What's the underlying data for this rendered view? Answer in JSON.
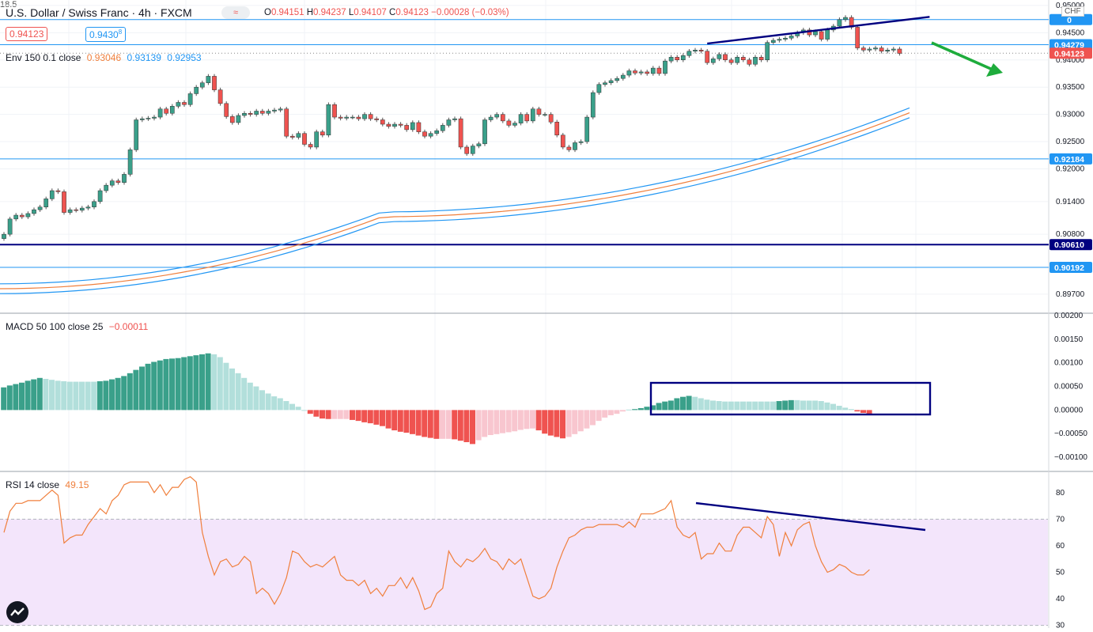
{
  "header": {
    "title": "U.S. Dollar / Swiss Franc · 4h · FXCM",
    "ohlc": {
      "o_label": "O",
      "o": "0.94151",
      "h_label": "H",
      "h": "0.94237",
      "l_label": "L",
      "l": "0.94107",
      "c_label": "C",
      "c": "0.94123",
      "chg": "−0.00028 (−0.03%)"
    },
    "bid": "0.94123",
    "spread": "18.5",
    "ask": "0.9430",
    "ask_sup": "8",
    "currency": "CHF",
    "compare_icon": "≈"
  },
  "colors": {
    "up": "#3aa08a",
    "down": "#ef5350",
    "up_light": "#b2dfdb",
    "down_light": "#f8c6cf",
    "env_mid": "#f07f3c",
    "env_band": "#2196f3",
    "trend": "#000080",
    "arrow": "#1eac3c",
    "rsi": "#f07f3c",
    "rsi_band": "#f3e5fb"
  },
  "indicators": {
    "env": {
      "label": "Env 150 0.1 close",
      "v1": "0.93046",
      "v2": "0.93139",
      "v3": "0.92953"
    },
    "macd": {
      "label": "MACD 50 100 close 25",
      "value": "−0.00011"
    },
    "rsi": {
      "label": "RSI 14 close",
      "value": "49.15"
    }
  },
  "chart_data": [
    {
      "type": "candlestick",
      "name": "price",
      "ylim": [
        0.8935,
        0.951
      ],
      "y_ticks": [
        "0.95000",
        "0.94500",
        "0.94000",
        "0.93500",
        "0.93000",
        "0.92500",
        "0.92000",
        "0.91400",
        "0.90800",
        "0.89700"
      ],
      "tick_values": [
        0.95,
        0.945,
        0.94,
        0.935,
        0.93,
        0.925,
        0.92,
        0.914,
        0.908,
        0.897
      ],
      "horizontal_levels": [
        {
          "value": 0.9474,
          "label": "0",
          "color": "#2196f3"
        },
        {
          "value": 0.94279,
          "label": "0.94279",
          "color": "#2196f3"
        },
        {
          "value": 0.94123,
          "label": "0.94123",
          "color": "#ef5350"
        },
        {
          "value": 0.92184,
          "label": "0.92184",
          "color": "#2196f3"
        },
        {
          "value": 0.9061,
          "label": "0.90610",
          "color": "#000080"
        },
        {
          "value": 0.90192,
          "label": "0.90192",
          "color": "#2196f3"
        }
      ],
      "closes": [
        0.908,
        0.9108,
        0.9115,
        0.9112,
        0.9118,
        0.9125,
        0.913,
        0.9145,
        0.916,
        0.9158,
        0.912,
        0.9125,
        0.9124,
        0.9128,
        0.913,
        0.914,
        0.916,
        0.917,
        0.9178,
        0.9175,
        0.919,
        0.9235,
        0.929,
        0.9292,
        0.9293,
        0.9295,
        0.931,
        0.9302,
        0.9315,
        0.9322,
        0.9318,
        0.9338,
        0.935,
        0.9358,
        0.937,
        0.9345,
        0.932,
        0.9296,
        0.9285,
        0.9298,
        0.9302,
        0.93,
        0.9306,
        0.9302,
        0.9306,
        0.9308,
        0.931,
        0.926,
        0.9258,
        0.9265,
        0.9245,
        0.924,
        0.9268,
        0.9262,
        0.9318,
        0.9295,
        0.9293,
        0.9295,
        0.9295,
        0.9292,
        0.93,
        0.9292,
        0.929,
        0.9282,
        0.9278,
        0.9282,
        0.928,
        0.9272,
        0.9285,
        0.9268,
        0.926,
        0.9265,
        0.927,
        0.928,
        0.929,
        0.9292,
        0.924,
        0.9228,
        0.9242,
        0.9246,
        0.929,
        0.9295,
        0.93,
        0.9288,
        0.928,
        0.9284,
        0.93,
        0.9288,
        0.931,
        0.93,
        0.93,
        0.9286,
        0.9262,
        0.924,
        0.9235,
        0.9248,
        0.925,
        0.9295,
        0.934,
        0.9355,
        0.9358,
        0.9362,
        0.9366,
        0.9372,
        0.938,
        0.9376,
        0.9378,
        0.9375,
        0.9385,
        0.9375,
        0.9398,
        0.9405,
        0.94,
        0.9408,
        0.9416,
        0.9418,
        0.9416,
        0.9395,
        0.9402,
        0.941,
        0.94,
        0.9395,
        0.9405,
        0.94,
        0.9392,
        0.9405,
        0.94,
        0.9432,
        0.9436,
        0.9438,
        0.944,
        0.9444,
        0.945,
        0.9455,
        0.9446,
        0.9452,
        0.9438,
        0.9455,
        0.9462,
        0.9474,
        0.9478,
        0.946,
        0.9422,
        0.9418,
        0.942,
        0.9422,
        0.9416,
        0.9418,
        0.942,
        0.9412
      ],
      "envelope": {
        "upper": [
          0.8989,
          0.9121,
          0.9312
        ],
        "middle": [
          0.898,
          0.9112,
          0.9303
        ],
        "lower": [
          0.8971,
          0.9103,
          0.9294
        ],
        "x": [
          0,
          0.42,
          1
        ]
      },
      "trendline": {
        "from": [
          117,
          0.943
        ],
        "to": [
          154,
          0.9479
        ]
      },
      "arrow": {
        "direction": "down-right"
      }
    },
    {
      "type": "histogram",
      "name": "MACD 50 100 close 25",
      "ylim": [
        -0.0013,
        0.00205
      ],
      "y_ticks": [
        "0.00200",
        "0.00150",
        "0.00100",
        "0.00050",
        "0.00000",
        "−0.00050",
        "−0.00100"
      ],
      "tick_values": [
        0.002,
        0.0015,
        0.001,
        0.0005,
        0.0,
        -0.0005,
        -0.001
      ],
      "values": [
        0.00048,
        0.00052,
        0.00055,
        0.00058,
        0.00062,
        0.00065,
        0.00068,
        0.00066,
        0.00064,
        0.00062,
        0.00061,
        0.0006,
        0.0006,
        0.0006,
        0.0006,
        0.0006,
        0.00061,
        0.00062,
        0.00065,
        0.00068,
        0.00072,
        0.00078,
        0.00085,
        0.00092,
        0.00098,
        0.00102,
        0.00105,
        0.00108,
        0.00109,
        0.0011,
        0.00112,
        0.00114,
        0.00116,
        0.00118,
        0.0012,
        0.00118,
        0.00112,
        0.001,
        0.00088,
        0.00078,
        0.00068,
        0.00058,
        0.0005,
        0.00042,
        0.00035,
        0.00029,
        0.00025,
        0.00019,
        0.00013,
        7e-05,
        0.0,
        -8e-05,
        -0.00014,
        -0.00018,
        -0.00019,
        -0.00019,
        -0.00019,
        -0.00019,
        -0.00021,
        -0.00023,
        -0.00026,
        -0.00028,
        -0.00031,
        -0.00034,
        -0.00039,
        -0.00043,
        -0.00046,
        -0.00048,
        -0.00051,
        -0.00054,
        -0.00057,
        -0.00059,
        -0.00061,
        -0.00061,
        -0.00061,
        -0.00062,
        -0.00065,
        -0.00068,
        -0.00072,
        -0.00064,
        -0.00057,
        -0.00053,
        -0.00051,
        -0.00049,
        -0.00047,
        -0.00045,
        -0.00042,
        -0.0004,
        -0.00039,
        -0.00043,
        -0.0005,
        -0.00054,
        -0.00057,
        -0.0006,
        -0.00057,
        -0.00051,
        -0.00045,
        -0.00039,
        -0.00032,
        -0.00023,
        -0.00016,
        -0.00011,
        -8e-05,
        -3e-05,
        1e-05,
        2e-05,
        4e-05,
        7e-05,
        0.0001,
        0.00015,
        0.00018,
        0.0002,
        0.00025,
        0.00028,
        0.0003,
        0.00028,
        0.00025,
        0.00022,
        0.0002,
        0.00019,
        0.00018,
        0.00018,
        0.00018,
        0.00018,
        0.00018,
        0.00018,
        0.00018,
        0.00018,
        0.00018,
        0.00019,
        0.0002,
        0.00021,
        0.00021,
        0.0002,
        0.0002,
        0.0002,
        0.00019,
        0.00016,
        0.00013,
        9e-05,
        5e-05,
        2e-05,
        -3e-05,
        -6e-05,
        -9e-05
      ]
    },
    {
      "type": "line",
      "name": "RSI 14 close",
      "ylim": [
        29,
        88
      ],
      "y_ticks": [
        "80",
        "70",
        "60",
        "50",
        "40",
        "30"
      ],
      "tick_values": [
        80,
        70,
        60,
        50,
        40,
        30
      ],
      "band": [
        30,
        70
      ],
      "values": [
        65,
        73,
        76,
        76,
        77,
        77,
        77,
        79,
        81,
        79,
        61,
        63,
        64,
        64,
        68,
        71,
        74,
        72,
        77,
        79,
        83,
        84,
        84,
        84,
        84,
        80,
        83,
        79,
        82,
        82,
        85,
        86,
        84,
        65,
        56,
        49,
        54,
        55,
        52,
        53,
        56,
        54,
        42,
        44,
        42,
        38,
        42,
        48,
        58,
        57,
        54,
        52,
        53,
        52,
        54,
        56,
        49,
        47,
        47,
        45,
        47,
        42,
        44,
        41,
        45,
        45,
        48,
        44,
        48,
        43,
        36,
        37,
        42,
        44,
        58,
        54,
        52,
        55,
        54,
        56,
        59,
        55,
        54,
        51,
        55,
        53,
        55,
        48,
        41,
        40,
        41,
        44,
        52,
        58,
        63,
        64,
        66,
        67,
        67,
        68,
        68,
        68,
        68,
        67,
        69,
        67,
        72,
        72,
        72,
        73,
        74,
        77,
        67,
        64,
        63,
        65,
        55,
        57,
        57,
        61,
        58,
        58,
        64,
        67,
        67,
        65,
        63,
        71,
        68,
        56,
        65,
        60,
        66,
        68,
        69,
        60,
        54,
        50,
        51,
        53,
        52,
        50,
        49,
        49,
        51
      ]
    }
  ]
}
